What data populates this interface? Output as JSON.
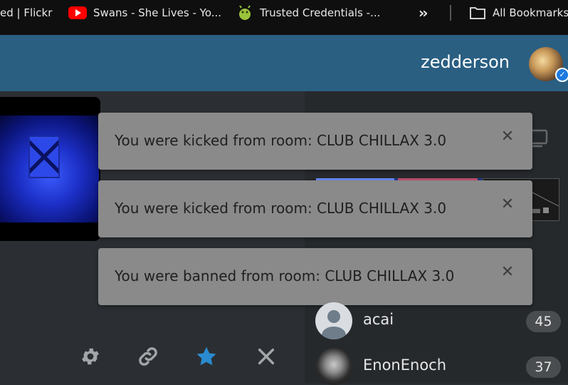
{
  "bookmarks": {
    "items": [
      {
        "label": "ed | Flickr",
        "icon": "none"
      },
      {
        "label": "Swans - She Lives - Yo...",
        "icon": "youtube-icon"
      },
      {
        "label": "Trusted Credentials -...",
        "icon": "android-icon"
      }
    ],
    "overflow_icon": "double-chevron-right-icon",
    "all_bookmarks_label": "All Bookmarks",
    "folder_icon": "folder-icon"
  },
  "header": {
    "username": "zedderson",
    "avatar_icon": "user-avatar",
    "verified_icon": "checkmark-badge-icon",
    "background": "#2a5f82"
  },
  "notifications": [
    {
      "message": "You were kicked from room: CLUB CHILLAX 3.0",
      "close_label": "✕"
    },
    {
      "message": "You were kicked from room: CLUB CHILLAX 3.0",
      "close_label": "✕"
    },
    {
      "message": "You were banned from room: CLUB CHILLAX 3.0",
      "close_label": "✕"
    }
  ],
  "toolbar": {
    "settings_icon": "gear-icon",
    "link_icon": "link-icon",
    "favorite_icon": "star-icon",
    "close_icon": "close-icon",
    "favorite_color": "#2a8bd0"
  },
  "users": [
    {
      "name": "acai",
      "count": "45"
    },
    {
      "name": "EnonEnoch",
      "count": "37"
    }
  ]
}
